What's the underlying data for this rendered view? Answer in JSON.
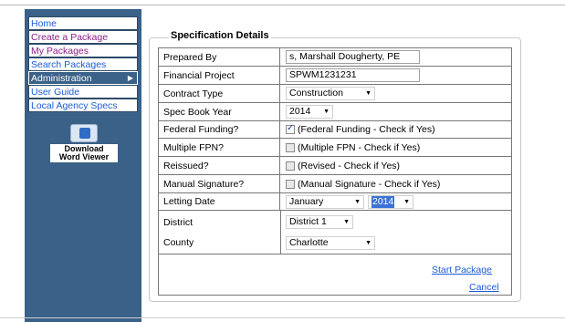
{
  "sidebar": {
    "items": [
      {
        "label": "Home",
        "color": "#1d5bd6"
      },
      {
        "label": "Create a Package",
        "color": "#8b1d8b"
      },
      {
        "label": "My Packages",
        "color": "#8b1d8b"
      },
      {
        "label": "Search Packages",
        "color": "#1d5bd6"
      },
      {
        "label": "Administration",
        "color": "#ffffff"
      },
      {
        "label": "User Guide",
        "color": "#1d5bd6"
      },
      {
        "label": "Local Agency Specs",
        "color": "#1d5bd6"
      }
    ],
    "admin_arrow": "▶",
    "word_viewer": {
      "line1": "Download",
      "line2": "Word Viewer",
      "icon": "word-viewer-icon"
    }
  },
  "form": {
    "title": "Specification Details",
    "prepared_by": {
      "label": "Prepared By",
      "value": "s, Marshall Dougherty, PE"
    },
    "financial_project": {
      "label": "Financial Project",
      "value": "SPWM1231231"
    },
    "contract_type": {
      "label": "Contract Type",
      "value": "Construction"
    },
    "spec_book_year": {
      "label": "Spec Book Year",
      "value": "2014"
    },
    "federal_funding": {
      "label": "Federal Funding?",
      "text": "(Federal Funding - Check if Yes)",
      "checked": true
    },
    "multiple_fpn": {
      "label": "Multiple FPN?",
      "text": "(Multiple FPN - Check if Yes)",
      "checked": false
    },
    "reissued": {
      "label": "Reissued?",
      "text": "(Revised - Check if Yes)",
      "checked": false
    },
    "manual_signature": {
      "label": "Manual Signature?",
      "text": "(Manual Signature - Check if Yes)",
      "checked": false
    },
    "letting_date": {
      "label": "Letting Date",
      "month": "January",
      "year": "2014"
    },
    "district": {
      "label": "District",
      "value": "District 1"
    },
    "county": {
      "label": "County",
      "value": "Charlotte"
    },
    "start_package": "Start Package",
    "cancel": "Cancel"
  },
  "colors": {
    "sidebar_bg": "#3a6187",
    "link": "#1d5bd6",
    "purple_link": "#8b1d8b",
    "highlight": "#3a73d8"
  }
}
